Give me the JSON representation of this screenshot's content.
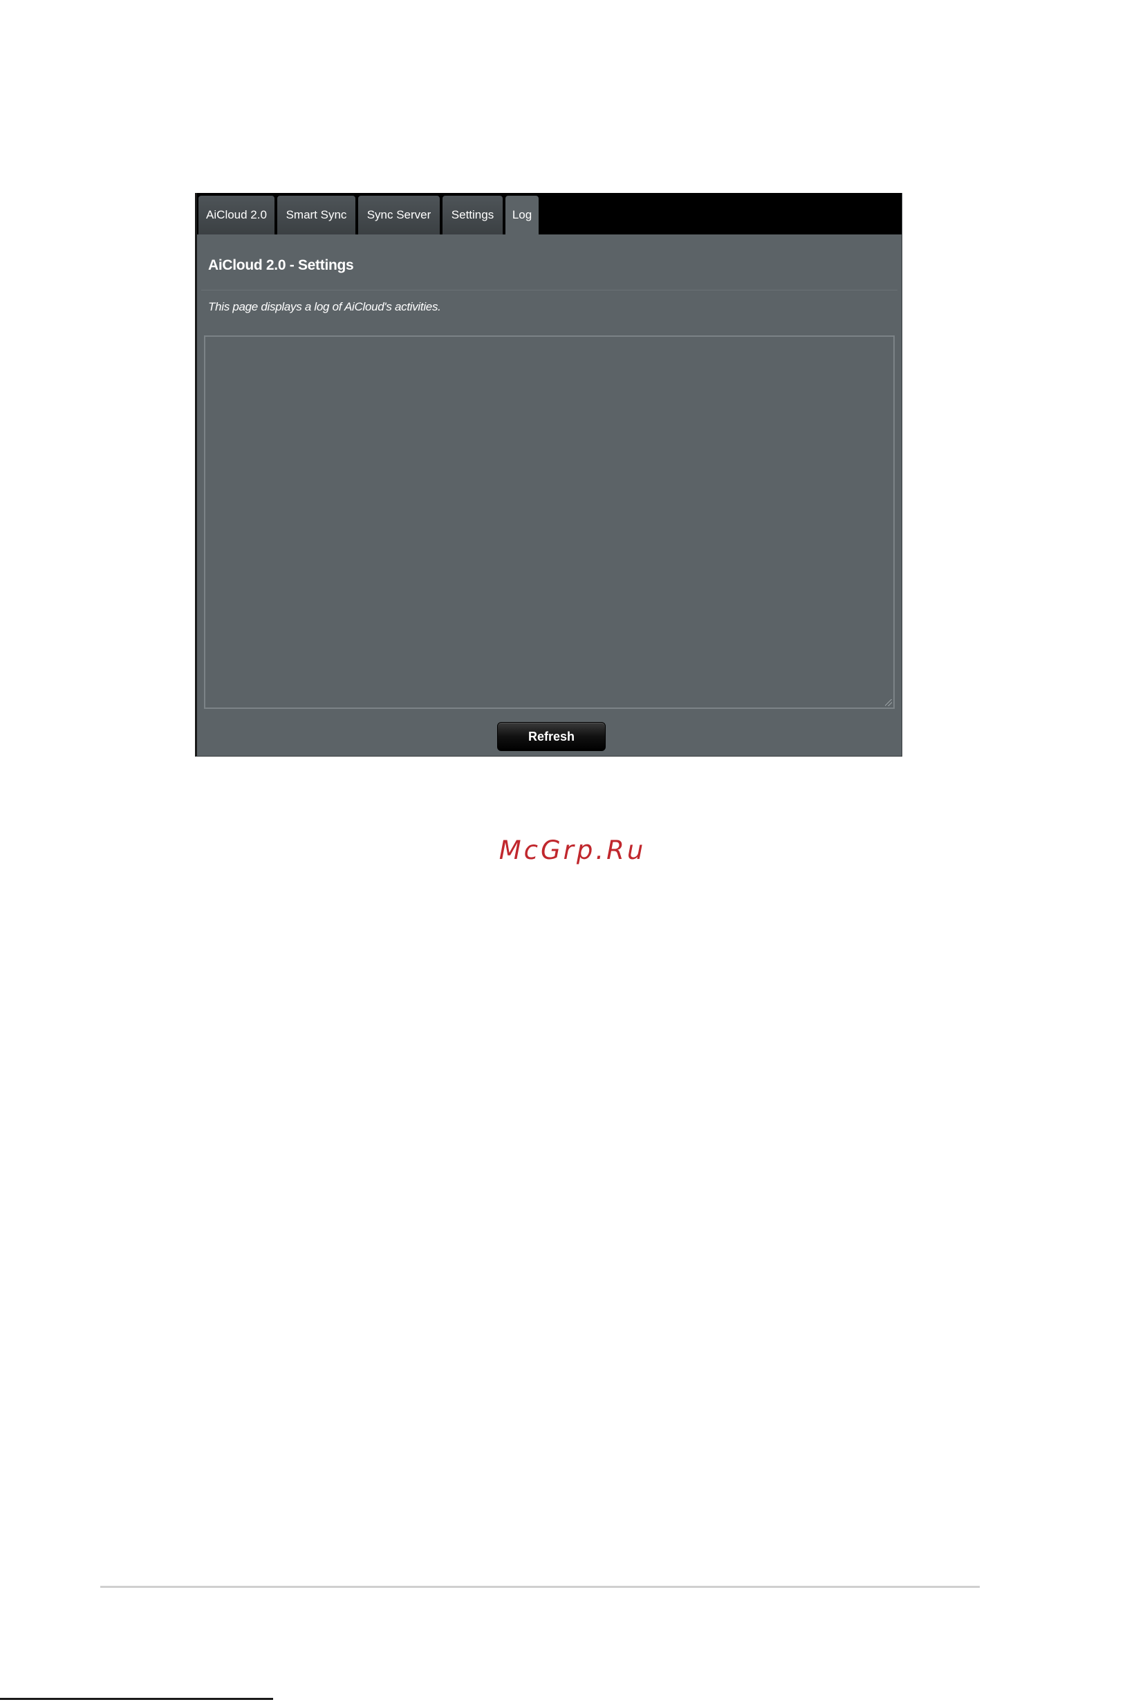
{
  "app": {
    "tabs": [
      {
        "label": "AiCloud 2.0",
        "active": false
      },
      {
        "label": "Smart Sync",
        "active": false
      },
      {
        "label": "Sync Server",
        "active": false
      },
      {
        "label": "Settings",
        "active": false
      },
      {
        "label": "Log",
        "active": true
      }
    ],
    "title": "AiCloud 2.0 - Settings",
    "description": "This page displays a log of AiCloud's activities.",
    "log_content": "",
    "refresh_label": "Refresh"
  },
  "watermark": {
    "text": "McGrp.Ru"
  },
  "colors": {
    "panel_bg": "#5c6367",
    "tabbar_bg": "#000000",
    "watermark": "#c0272d"
  }
}
